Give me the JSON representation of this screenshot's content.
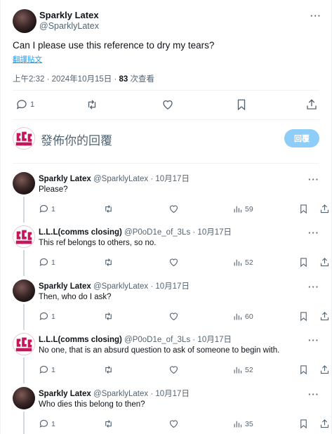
{
  "main": {
    "name": "Sparkly Latex",
    "handle": "@SparklyLatex",
    "text": "Can I please use this reference to dry my tears?",
    "translate": "翻譯貼文",
    "time": "上午2:32 · 2024年10月15日 · ",
    "views": "83",
    "views_label": " 次查看",
    "reply_count": "1"
  },
  "compose": {
    "placeholder": "發佈你的回覆",
    "button": "回覆"
  },
  "more_glyph": "···",
  "replies": [
    {
      "name": "Sparkly Latex",
      "handle": "@SparklyLatex · 10月17日",
      "text": "Please?",
      "replies": "1",
      "views": "59",
      "avatar": "dark"
    },
    {
      "name": "L.L.L(comms closing)",
      "handle": "@P0oD1e_of_3Ls · 10月17日",
      "text": "This ref belongs to others, so no.",
      "replies": "1",
      "views": "52",
      "avatar": "pink"
    },
    {
      "name": "Sparkly Latex",
      "handle": "@SparklyLatex · 10月17日",
      "text": "Then, who do I ask?",
      "replies": "1",
      "views": "60",
      "avatar": "dark"
    },
    {
      "name": "L.L.L(comms closing)",
      "handle": "@P0oD1e_of_3Ls · 10月17日",
      "text": "No one, that is an absurd question to ask of someone to begin with.",
      "replies": "1",
      "views": "52",
      "avatar": "pink"
    },
    {
      "name": "Sparkly Latex",
      "handle": "@SparklyLatex · 10月17日",
      "text": "Who dies this belong to then?",
      "replies": "1",
      "views": "35",
      "avatar": "dark"
    }
  ],
  "colors": {
    "accent": "#1d9bf0",
    "reply_button": "#8ecdf8",
    "muted_text": "#536471",
    "divider": "#eff3f4"
  }
}
